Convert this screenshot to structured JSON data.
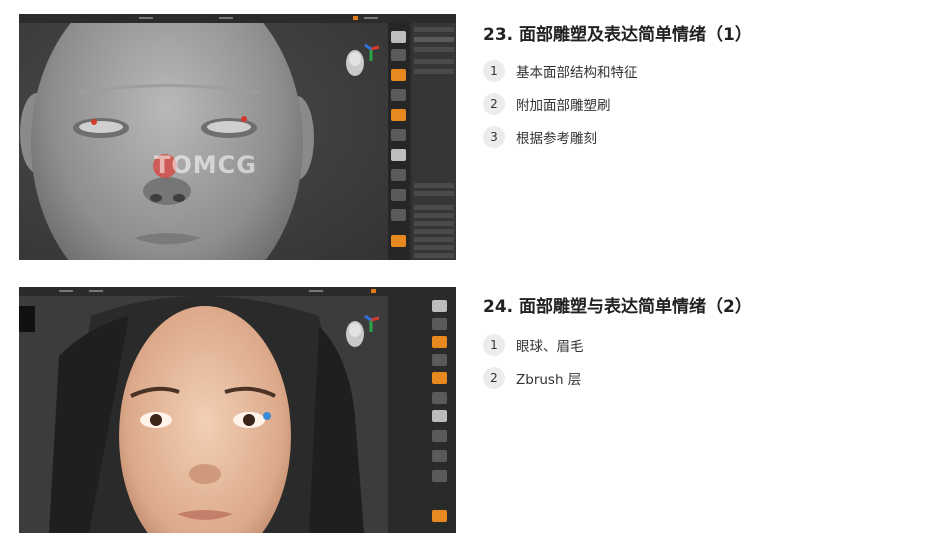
{
  "sections": [
    {
      "title": "23. 面部雕塑及表达简单情绪（1）",
      "items": [
        {
          "num": "1",
          "label": "基本面部结构和特征"
        },
        {
          "num": "2",
          "label": "附加面部雕塑刷"
        },
        {
          "num": "3",
          "label": "根据参考雕刻"
        }
      ],
      "watermark": "TOMCG",
      "screenshot_subject": "gray-sculpted-face"
    },
    {
      "title": "24. 面部雕塑与表达简单情绪（2）",
      "items": [
        {
          "num": "1",
          "label": "眼球、眉毛"
        },
        {
          "num": "2",
          "label": "Zbrush 层"
        }
      ],
      "screenshot_subject": "painted-face-with-dark-hair"
    }
  ],
  "colors": {
    "accent": "#e8891f",
    "background": "#ffffff",
    "number_badge": "#ececec",
    "title_text": "#222222"
  }
}
